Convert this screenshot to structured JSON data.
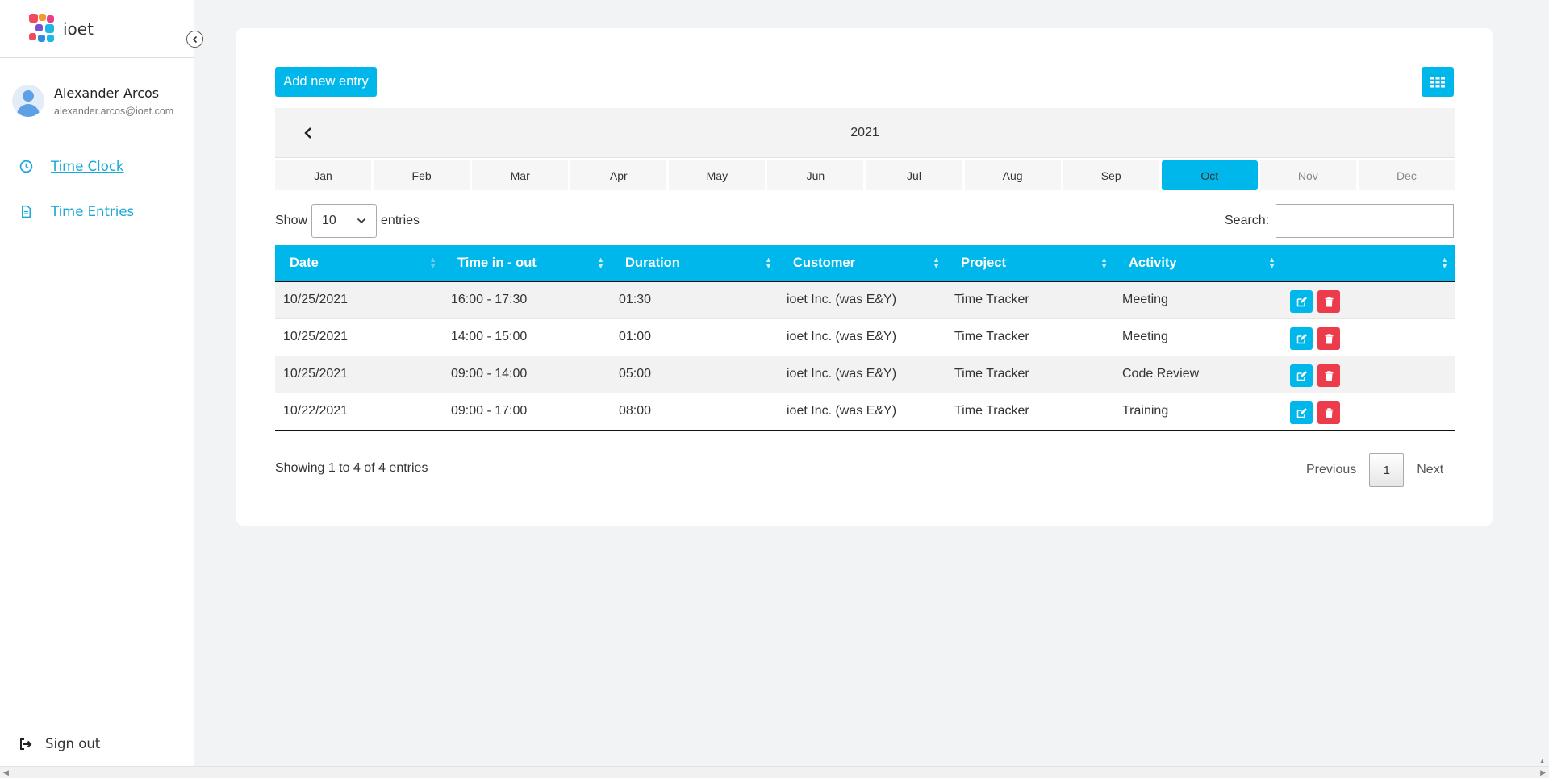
{
  "brand": {
    "name": "ioet",
    "colors": [
      "#f04a5b",
      "#f59a2b",
      "#7a4fd2",
      "#1bb8e6",
      "#2d8fd8",
      "#e83e8c"
    ]
  },
  "user": {
    "name": "Alexander Arcos",
    "email": "alexander.arcos@ioet.com"
  },
  "nav": [
    {
      "label": "Time Clock",
      "icon": "clock-icon"
    },
    {
      "label": "Time Entries",
      "icon": "file-icon"
    }
  ],
  "signout": {
    "label": "Sign out",
    "icon": "sign-out-icon"
  },
  "toolbar": {
    "add_label": "Add new entry",
    "grid_icon": "table-grid-icon"
  },
  "calendar": {
    "year": "2021",
    "months": [
      "Jan",
      "Feb",
      "Mar",
      "Apr",
      "May",
      "Jun",
      "Jul",
      "Aug",
      "Sep",
      "Oct",
      "Nov",
      "Dec"
    ],
    "selected": "Oct"
  },
  "length": {
    "show": "Show",
    "value": "10",
    "entries": "entries"
  },
  "search": {
    "label": "Search:",
    "value": ""
  },
  "table": {
    "columns": [
      "Date",
      "Time in - out",
      "Duration",
      "Customer",
      "Project",
      "Activity",
      ""
    ],
    "rows": [
      [
        "10/25/2021",
        "16:00 - 17:30",
        "01:30",
        "ioet Inc. (was E&Y)",
        "Time Tracker",
        "Meeting"
      ],
      [
        "10/25/2021",
        "14:00 - 15:00",
        "01:00",
        "ioet Inc. (was E&Y)",
        "Time Tracker",
        "Meeting"
      ],
      [
        "10/25/2021",
        "09:00 - 14:00",
        "05:00",
        "ioet Inc. (was E&Y)",
        "Time Tracker",
        "Code Review"
      ],
      [
        "10/22/2021",
        "09:00 - 17:00",
        "08:00",
        "ioet Inc. (was E&Y)",
        "Time Tracker",
        "Training"
      ]
    ]
  },
  "footer": {
    "info": "Showing 1 to 4 of 4 entries",
    "previous": "Previous",
    "current_page": "1",
    "next": "Next"
  },
  "accent_colors": {
    "primary": "#00b7ec",
    "danger": "#ec3b4b",
    "link": "#1aa8d8"
  }
}
